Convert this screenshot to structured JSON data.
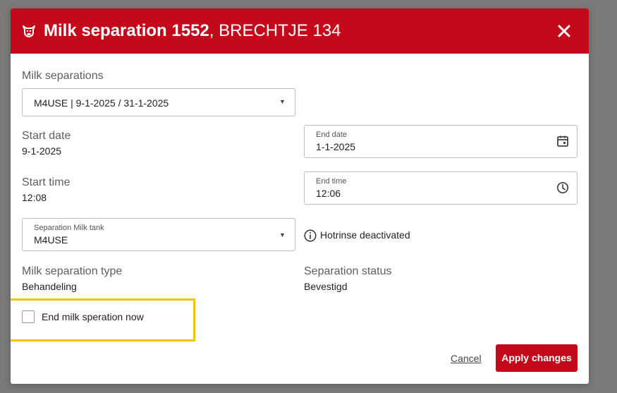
{
  "header": {
    "title_bold": "Milk separation 1552",
    "title_rest": ", BRECHTJE 134",
    "icon": "cow-icon",
    "close_icon": "close-icon",
    "bg_color": "#c40a1a"
  },
  "milk_separations": {
    "label": "Milk separations",
    "selected": "M4USE | 9-1-2025 / 31-1-2025"
  },
  "start_date": {
    "label": "Start date",
    "value": "9-1-2025"
  },
  "end_date": {
    "label": "End date",
    "value": "1-1-2025",
    "icon": "calendar-icon"
  },
  "start_time": {
    "label": "Start time",
    "value": "12:08"
  },
  "end_time": {
    "label": "End time",
    "value": "12:06",
    "icon": "clock-icon"
  },
  "milk_tank": {
    "label": "Separation Milk tank",
    "selected": "M4USE"
  },
  "hotrinse": {
    "text": "Hotrinse deactivated",
    "icon": "info-icon"
  },
  "separation_type": {
    "label": "Milk separation type",
    "value": "Behandeling"
  },
  "separation_status": {
    "label": "Separation status",
    "value": "Bevestigd"
  },
  "end_now": {
    "label": "End milk speration now",
    "checked": false,
    "highlight_color": "#f5c400"
  },
  "actions": {
    "cancel": "Cancel",
    "apply": "Apply changes"
  }
}
